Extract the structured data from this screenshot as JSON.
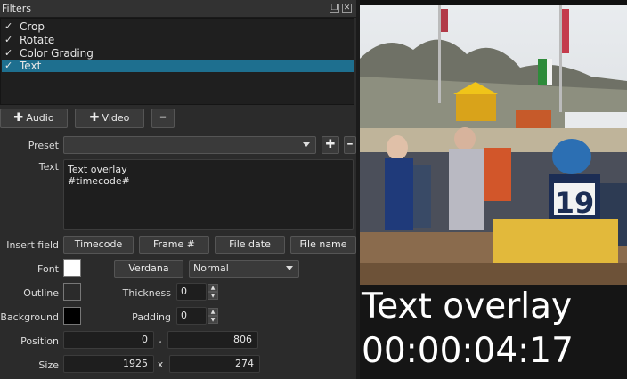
{
  "panel": {
    "title": "Filters"
  },
  "filters": [
    {
      "label": "Crop",
      "checked": "✓"
    },
    {
      "label": "Rotate",
      "checked": "✓"
    },
    {
      "label": "Color Grading",
      "checked": "✓"
    },
    {
      "label": "Text",
      "checked": "✓"
    }
  ],
  "buttons": {
    "audio": "Audio",
    "video": "Video",
    "remove": "━"
  },
  "form": {
    "preset_label": "Preset",
    "text_label": "Text",
    "text_value": "Text overlay\n#timecode#",
    "insert_field_label": "Insert field",
    "insert_timecode": "Timecode",
    "insert_frame": "Frame #",
    "insert_filedate": "File date",
    "insert_filename": "File name",
    "font_label": "Font",
    "font_name": "Verdana",
    "font_weight": "Normal",
    "outline_label": "Outline",
    "thickness_label": "Thickness",
    "thickness_value": "0",
    "background_label": "Background",
    "padding_label": "Padding",
    "padding_value": "0",
    "position_label": "Position",
    "position_x": "0",
    "position_sep": ",",
    "position_y": "806",
    "size_label": "Size",
    "size_w": "1925",
    "size_sep": "x",
    "size_h": "274"
  },
  "preview": {
    "overlay_line1": "Text overlay",
    "overlay_line2": "00:00:04:17",
    "rider_number": "19"
  },
  "colors": {
    "selection": "#1e6f8f",
    "font_color": "#ffffff",
    "outline_color": "#2b2b2b",
    "background_color": "#000000"
  }
}
